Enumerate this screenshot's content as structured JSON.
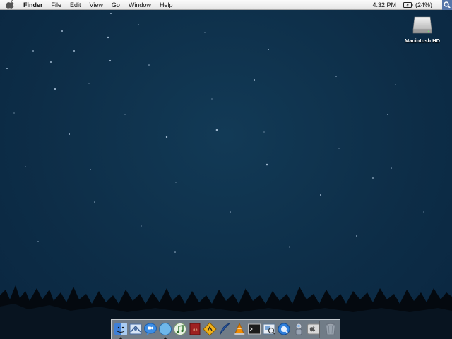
{
  "menubar": {
    "items": [
      "Finder",
      "File",
      "Edit",
      "View",
      "Go",
      "Window",
      "Help"
    ],
    "clock": "4:32 PM",
    "battery": "(24%)"
  },
  "desktop": {
    "icons": [
      {
        "label": "Macintosh HD",
        "icon": "hard-drive-icon"
      }
    ]
  },
  "dock": {
    "items": [
      {
        "icon": "finder-icon",
        "running": true
      },
      {
        "icon": "mail-icon",
        "running": false
      },
      {
        "icon": "ichat-icon",
        "running": false
      },
      {
        "icon": "safari-icon",
        "running": true
      },
      {
        "icon": "itunes-icon",
        "running": false
      },
      {
        "icon": "dictionary-icon",
        "running": false
      },
      {
        "icon": "network-utility-icon",
        "running": false
      },
      {
        "icon": "quill-icon",
        "running": false
      },
      {
        "icon": "vlc-icon",
        "running": false
      },
      {
        "icon": "terminal-icon",
        "running": false
      },
      {
        "icon": "preview-icon",
        "running": false
      },
      {
        "icon": "quicktime-icon",
        "running": false
      },
      {
        "icon": "automator-icon",
        "running": false
      },
      {
        "icon": "system-preferences-icon",
        "running": false
      },
      {
        "icon": "trash-icon",
        "running": false
      }
    ]
  }
}
